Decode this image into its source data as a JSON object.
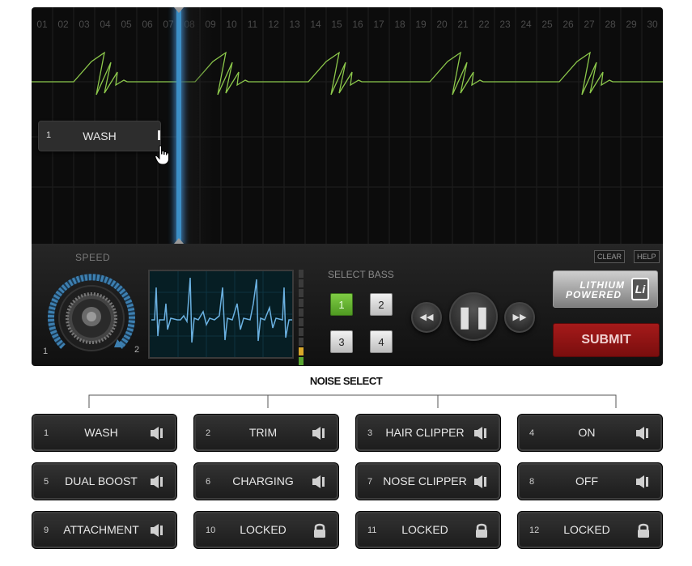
{
  "sequencer": {
    "columns": [
      "01",
      "02",
      "03",
      "04",
      "05",
      "06",
      "07",
      "08",
      "09",
      "10",
      "11",
      "12",
      "13",
      "14",
      "15",
      "16",
      "17",
      "18",
      "19",
      "20",
      "21",
      "22",
      "23",
      "24",
      "25",
      "26",
      "27",
      "28",
      "29",
      "30"
    ],
    "track_item": {
      "number": "1",
      "label": "WASH"
    },
    "wave_color": "#8cc84b",
    "playhead_color": "#3c8fc6"
  },
  "controls": {
    "speed_label": "SPEED",
    "knob_min": "1",
    "knob_max": "2",
    "bass_label": "SELECT BASS",
    "bass_buttons": [
      {
        "label": "1",
        "selected": true
      },
      {
        "label": "2",
        "selected": false
      },
      {
        "label": "3",
        "selected": false
      },
      {
        "label": "4",
        "selected": false
      }
    ],
    "clear_label": "CLEAR",
    "help_label": "HELP",
    "lithium_line1": "LITHIUM",
    "lithium_line2": "POWERED",
    "lithium_badge": "Li",
    "submit_label": "SUBMIT",
    "submit_color": "#8f1414"
  },
  "noise_select": {
    "title": "NOISE SELECT",
    "items": [
      {
        "number": "1",
        "label": "WASH",
        "icon": "speaker-icon"
      },
      {
        "number": "2",
        "label": "TRIM",
        "icon": "speaker-icon"
      },
      {
        "number": "3",
        "label": "HAIR CLIPPER",
        "icon": "speaker-icon"
      },
      {
        "number": "4",
        "label": "ON",
        "icon": "speaker-icon"
      },
      {
        "number": "5",
        "label": "DUAL BOOST",
        "icon": "speaker-icon"
      },
      {
        "number": "6",
        "label": "CHARGING",
        "icon": "speaker-icon"
      },
      {
        "number": "7",
        "label": "NOSE CLIPPER",
        "icon": "speaker-icon"
      },
      {
        "number": "8",
        "label": "OFF",
        "icon": "speaker-icon"
      },
      {
        "number": "9",
        "label": "ATTACHMENT",
        "icon": "speaker-icon"
      },
      {
        "number": "10",
        "label": "LOCKED",
        "icon": "lock-icon"
      },
      {
        "number": "11",
        "label": "LOCKED",
        "icon": "lock-icon"
      },
      {
        "number": "12",
        "label": "LOCKED",
        "icon": "lock-icon"
      }
    ]
  }
}
